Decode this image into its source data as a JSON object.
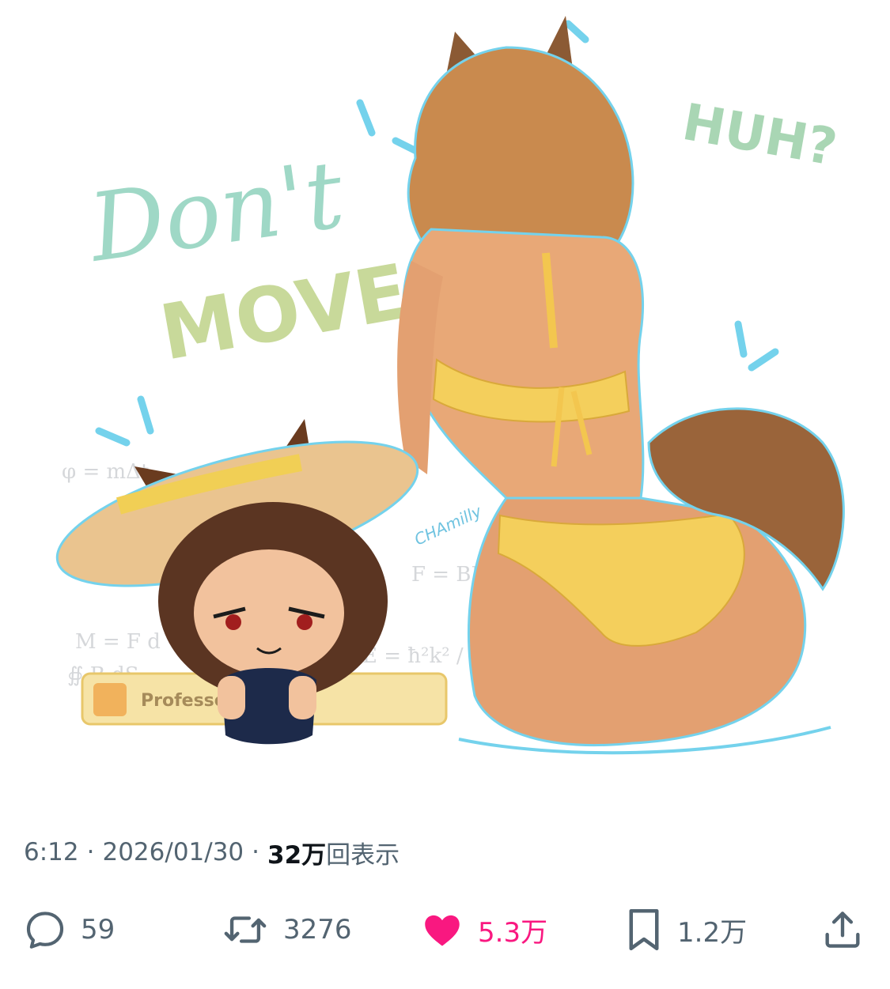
{
  "media": {
    "artwork_text": {
      "dont": "Don't",
      "move": "MOVE",
      "huh": "HUH?",
      "signature": "CHAmilly",
      "badge": "Professor Stature"
    },
    "formulas": [
      "M = F d",
      "E = ħ²k² / 2m",
      "∯ B·dS",
      "F = BIL",
      "φ = mΔt"
    ]
  },
  "meta": {
    "time": "6:12",
    "separator": "·",
    "date": "2026/01/30",
    "views_count": "32万",
    "views_label": "回表示"
  },
  "actions": {
    "reply_count": "59",
    "retweet_count": "3276",
    "like_count": "5.3万",
    "bookmark_count": "1.2万"
  },
  "colors": {
    "like_active": "#f91880",
    "muted": "#536471",
    "text": "#0f1419"
  },
  "icons": [
    "reply-icon",
    "retweet-icon",
    "heart-icon",
    "bookmark-icon",
    "share-icon"
  ]
}
